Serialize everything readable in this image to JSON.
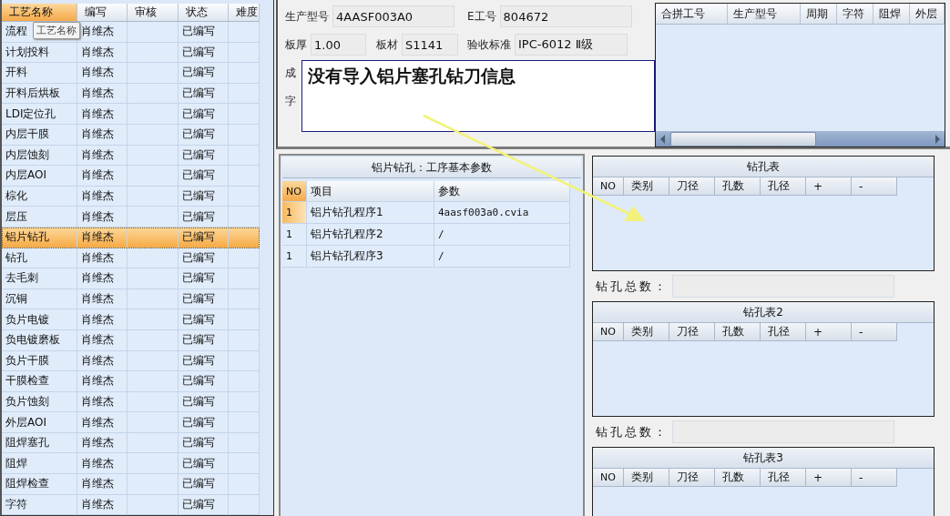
{
  "process_table": {
    "columns": [
      {
        "label": "工艺名称",
        "sorted": true
      },
      {
        "label": "编写",
        "sorted": false
      },
      {
        "label": "审核",
        "sorted": false
      },
      {
        "label": "状态",
        "sorted": false
      },
      {
        "label": "难度",
        "sorted": false
      }
    ],
    "tooltip": "工艺名称",
    "rows": [
      {
        "name": "流程",
        "author": "肖维杰",
        "status": "已编写",
        "selected": false
      },
      {
        "name": "计划投料",
        "author": "肖维杰",
        "status": "已编写",
        "selected": false
      },
      {
        "name": "开料",
        "author": "肖维杰",
        "status": "已编写",
        "selected": false
      },
      {
        "name": "开料后烘板",
        "author": "肖维杰",
        "status": "已编写",
        "selected": false
      },
      {
        "name": "LDI定位孔",
        "author": "肖维杰",
        "status": "已编写",
        "selected": false
      },
      {
        "name": "内层干膜",
        "author": "肖维杰",
        "status": "已编写",
        "selected": false
      },
      {
        "name": "内层蚀刻",
        "author": "肖维杰",
        "status": "已编写",
        "selected": false
      },
      {
        "name": "内层AOI",
        "author": "肖维杰",
        "status": "已编写",
        "selected": false
      },
      {
        "name": "棕化",
        "author": "肖维杰",
        "status": "已编写",
        "selected": false
      },
      {
        "name": "层压",
        "author": "肖维杰",
        "status": "已编写",
        "selected": false
      },
      {
        "name": "铝片钻孔",
        "author": "肖维杰",
        "status": "已编写",
        "selected": true
      },
      {
        "name": "钻孔",
        "author": "肖维杰",
        "status": "已编写",
        "selected": false
      },
      {
        "name": "去毛刺",
        "author": "肖维杰",
        "status": "已编写",
        "selected": false
      },
      {
        "name": "沉铜",
        "author": "肖维杰",
        "status": "已编写",
        "selected": false
      },
      {
        "name": "负片电镀",
        "author": "肖维杰",
        "status": "已编写",
        "selected": false
      },
      {
        "name": "负电镀磨板",
        "author": "肖维杰",
        "status": "已编写",
        "selected": false
      },
      {
        "name": "负片干膜",
        "author": "肖维杰",
        "status": "已编写",
        "selected": false
      },
      {
        "name": "干膜检查",
        "author": "肖维杰",
        "status": "已编写",
        "selected": false
      },
      {
        "name": "负片蚀刻",
        "author": "肖维杰",
        "status": "已编写",
        "selected": false
      },
      {
        "name": "外层AOI",
        "author": "肖维杰",
        "status": "已编写",
        "selected": false
      },
      {
        "name": "阻焊塞孔",
        "author": "肖维杰",
        "status": "已编写",
        "selected": false
      },
      {
        "name": "阻焊",
        "author": "肖维杰",
        "status": "已编写",
        "selected": false
      },
      {
        "name": "阻焊检查",
        "author": "肖维杰",
        "status": "已编写",
        "selected": false
      },
      {
        "name": "字符",
        "author": "肖维杰",
        "status": "已编写",
        "selected": false
      }
    ]
  },
  "job_form": {
    "fields": [
      {
        "label": "生产型号",
        "value": "4AASF003A0"
      },
      {
        "label": "E工号",
        "value": "804672"
      },
      {
        "label": "板厚",
        "value": "1.00"
      },
      {
        "label": "板材",
        "value": "S1141"
      },
      {
        "label": "验收标准",
        "value": "IPC-6012 Ⅱ级"
      }
    ],
    "covered_labels": [
      "成",
      "字"
    ]
  },
  "message_box": {
    "text": "没有导入铝片塞孔钻刀信息"
  },
  "merge_grid": {
    "columns": [
      "合拼工号",
      "生产型号",
      "周期",
      "字符",
      "阻焊",
      "外层"
    ]
  },
  "params_panel": {
    "title": "铝片钻孔：工序基本参数",
    "columns": [
      "NO",
      "项目",
      "参数"
    ],
    "rows": [
      {
        "no": "1",
        "item": "铝片钻孔程序1",
        "param": "4aasf003a0.cvia",
        "selected": true
      },
      {
        "no": "1",
        "item": "铝片钻孔程序2",
        "param": "/",
        "selected": false
      },
      {
        "no": "1",
        "item": "铝片钻孔程序3",
        "param": "/",
        "selected": false
      }
    ]
  },
  "drill_tables": [
    {
      "title": "钻孔表",
      "columns": [
        "NO",
        "类别",
        "刀径",
        "孔数",
        "孔径",
        "+",
        "-"
      ],
      "total_label": "钻孔总数："
    },
    {
      "title": "钻孔表2",
      "columns": [
        "NO",
        "类别",
        "刀径",
        "孔数",
        "孔径",
        "+",
        "-"
      ],
      "total_label": "钻孔总数："
    },
    {
      "title": "钻孔表3",
      "columns": [
        "NO",
        "类别",
        "刀径",
        "孔数",
        "孔径",
        "+",
        "-"
      ]
    }
  ]
}
